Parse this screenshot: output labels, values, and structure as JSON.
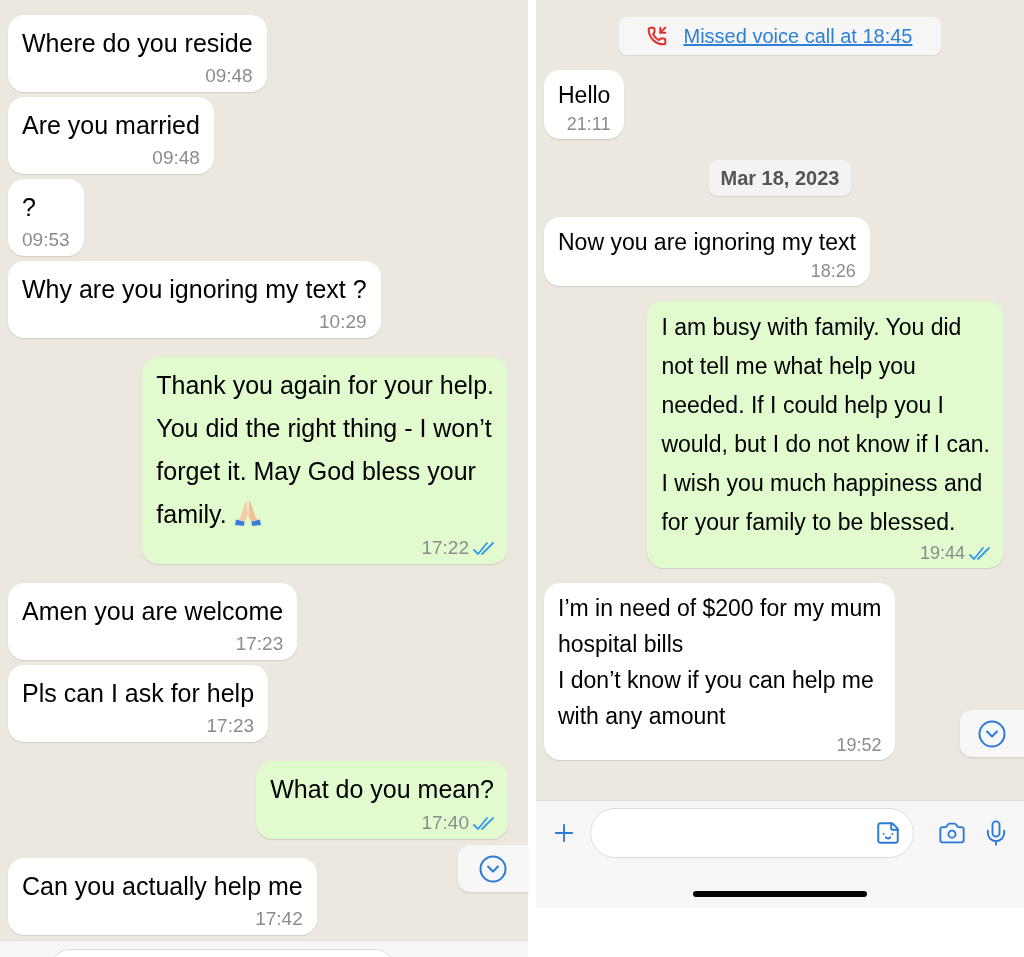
{
  "left_chat": {
    "messages": [
      {
        "kind": "in",
        "text": "Where do you reside",
        "time": "09:48"
      },
      {
        "kind": "in",
        "text": "Are you married",
        "time": "09:48"
      },
      {
        "kind": "in",
        "text": "?",
        "time": "09:53"
      },
      {
        "kind": "in",
        "text": "Why are you ignoring my text ?",
        "time": "10:29"
      },
      {
        "kind": "out",
        "text": "Thank you again for your help.\nYou did the right thing - I won’t\nforget it. May God bless your\nfamily.",
        "has_emoji": true,
        "time": "17:22",
        "read": true
      },
      {
        "kind": "in",
        "text": "Amen you are welcome",
        "time": "17:23"
      },
      {
        "kind": "in",
        "text": "Pls can I ask for help",
        "time": "17:23"
      },
      {
        "kind": "out",
        "text": "What do you mean?",
        "time": "17:40",
        "read": true
      },
      {
        "kind": "in",
        "text": "Can you actually help me",
        "time": "17:42"
      }
    ]
  },
  "right_chat": {
    "messages": [
      {
        "kind": "missed_call",
        "text": "Missed voice call at 18:45"
      },
      {
        "kind": "in",
        "text": "Hello",
        "time": "21:11"
      },
      {
        "kind": "date",
        "text": "Mar 18, 2023"
      },
      {
        "kind": "in",
        "text": "Now you are ignoring my text",
        "time": "18:26"
      },
      {
        "kind": "out",
        "text": "I am busy with family. You did\nnot tell me what help you\nneeded. If I could help you I\nwould, but I do not know if I can.\nI wish you much happiness and\nfor your family to be blessed.",
        "time": "19:44",
        "read": true
      },
      {
        "kind": "in",
        "text": "I’m in need of $200 for my mum\nhospital bills\nI don’t know if you can help me\nwith any amount",
        "time": "19:52"
      }
    ]
  }
}
